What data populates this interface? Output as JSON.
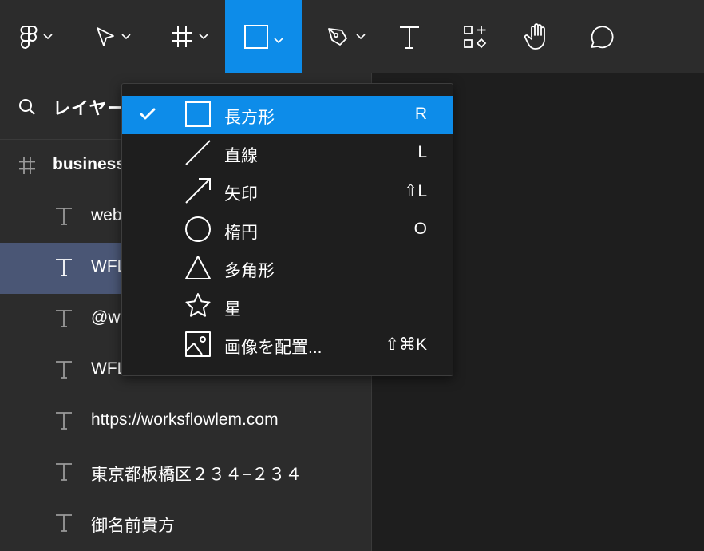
{
  "layers_panel": {
    "title": "レイヤー",
    "rows": [
      {
        "label": "business",
        "type": "frame"
      },
      {
        "label": "web",
        "type": "text"
      },
      {
        "label": "WFL",
        "type": "text",
        "selected": true
      },
      {
        "label": "@w",
        "type": "text"
      },
      {
        "label": "WFL",
        "type": "text"
      },
      {
        "label": "https://worksflowlem.com",
        "type": "text"
      },
      {
        "label": "東京都板橋区２３４−２３４",
        "type": "text"
      },
      {
        "label": "御名前貴方",
        "type": "text"
      }
    ]
  },
  "shape_menu": {
    "items": [
      {
        "label": "長方形",
        "shortcut": "R",
        "icon": "rectangle-icon",
        "checked": true
      },
      {
        "label": "直線",
        "shortcut": "L",
        "icon": "line-icon"
      },
      {
        "label": "矢印",
        "shortcut": "⇧L",
        "icon": "arrow-icon"
      },
      {
        "label": "楕円",
        "shortcut": "O",
        "icon": "ellipse-icon"
      },
      {
        "label": "多角形",
        "shortcut": "",
        "icon": "polygon-icon"
      },
      {
        "label": "星",
        "shortcut": "",
        "icon": "star-icon"
      },
      {
        "label": "画像を配置...",
        "shortcut": "⇧⌘K",
        "icon": "image-icon"
      }
    ]
  },
  "colors": {
    "accent": "#0d8ce9",
    "panel": "#2c2c2c",
    "canvas": "#1e1e1e",
    "selected_row": "#4a5675"
  }
}
